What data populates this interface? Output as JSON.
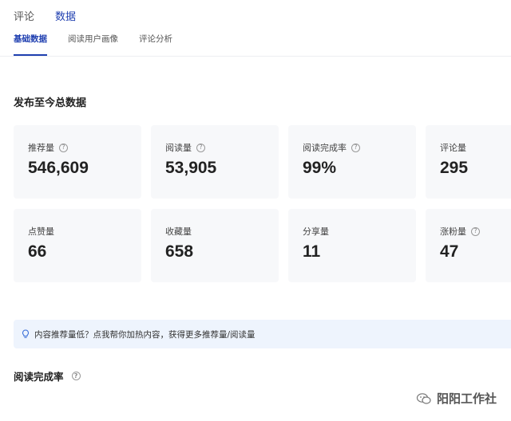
{
  "top_tabs": [
    {
      "label": "评论",
      "active": false
    },
    {
      "label": "数据",
      "active": true
    }
  ],
  "sub_tabs": [
    {
      "label": "基础数据",
      "active": true
    },
    {
      "label": "阅读用户画像",
      "active": false
    },
    {
      "label": "评论分析",
      "active": false
    }
  ],
  "section_title": "发布至今总数据",
  "stats": [
    {
      "label": "推荐量",
      "value": "546,609",
      "has_help": true
    },
    {
      "label": "阅读量",
      "value": "53,905",
      "has_help": true
    },
    {
      "label": "阅读完成率",
      "value": "99%",
      "has_help": true
    },
    {
      "label": "评论量",
      "value": "295",
      "has_help": false
    },
    {
      "label": "点赞量",
      "value": "66",
      "has_help": false
    },
    {
      "label": "收藏量",
      "value": "658",
      "has_help": false
    },
    {
      "label": "分享量",
      "value": "11",
      "has_help": false
    },
    {
      "label": "涨粉量",
      "value": "47",
      "has_help": true
    }
  ],
  "tip": {
    "text": "内容推荐量低？点我帮你加热内容，获得更多推荐量/阅读量",
    "icon": "lightbulb-icon"
  },
  "section2_title": "阅读完成率",
  "watermark": {
    "text": "阳阳工作社",
    "icon": "wechat-icon"
  },
  "help_glyph": "?",
  "colors": {
    "accent": "#1f3fb0",
    "card_bg": "#f7f8fa",
    "tip_bg": "#eef4fd"
  }
}
